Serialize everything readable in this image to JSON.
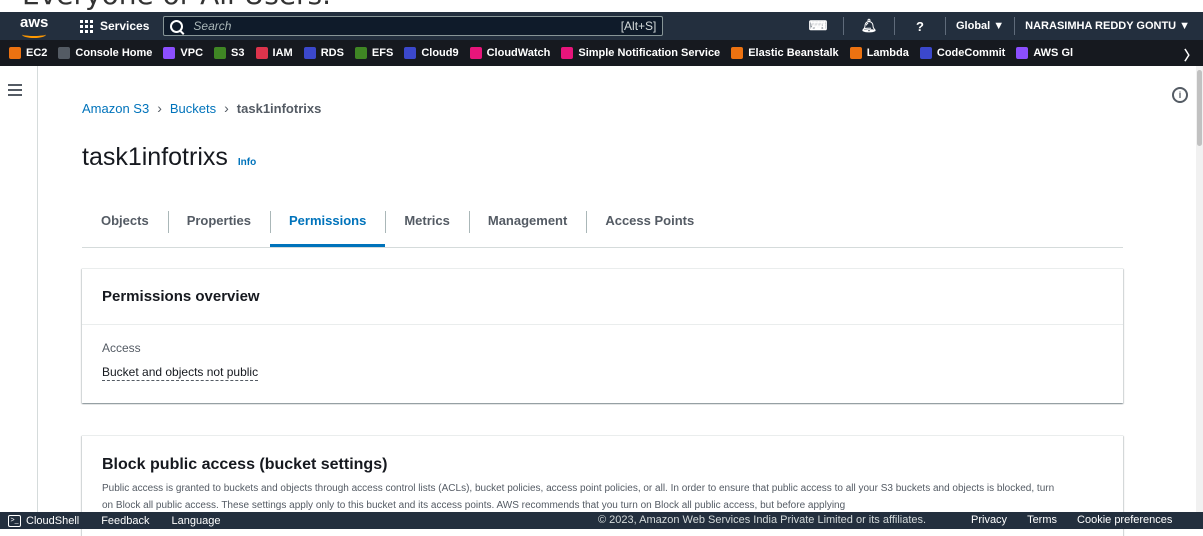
{
  "caption": "Everyone or All Users.",
  "topnav": {
    "logo": "aws",
    "services_label": "Services",
    "search_placeholder": "Search",
    "search_shortcut": "[Alt+S]",
    "region": "Global ▼",
    "account": "NARASIMHA REDDY GONTU ▼"
  },
  "favorites": [
    {
      "label": "EC2",
      "color": "#ec7211"
    },
    {
      "label": "Console Home",
      "color": "#545b64"
    },
    {
      "label": "VPC",
      "color": "#8c4fff"
    },
    {
      "label": "S3",
      "color": "#3f8624"
    },
    {
      "label": "IAM",
      "color": "#dd344c"
    },
    {
      "label": "RDS",
      "color": "#3b48cc"
    },
    {
      "label": "EFS",
      "color": "#3f8624"
    },
    {
      "label": "Cloud9",
      "color": "#3b48cc"
    },
    {
      "label": "CloudWatch",
      "color": "#e7157b"
    },
    {
      "label": "Simple Notification Service",
      "color": "#e7157b"
    },
    {
      "label": "Elastic Beanstalk",
      "color": "#ec7211"
    },
    {
      "label": "Lambda",
      "color": "#ec7211"
    },
    {
      "label": "CodeCommit",
      "color": "#3b48cc"
    },
    {
      "label": "AWS Gl",
      "color": "#8c4fff"
    }
  ],
  "breadcrumb": {
    "item1": "Amazon S3",
    "item2": "Buckets",
    "current": "task1infotrixs"
  },
  "page": {
    "title": "task1infotrixs",
    "info_link": "Info"
  },
  "tabs": [
    "Objects",
    "Properties",
    "Permissions",
    "Metrics",
    "Management",
    "Access Points"
  ],
  "permissions_overview": {
    "title": "Permissions overview",
    "access_label": "Access",
    "access_value": "Bucket and objects not public"
  },
  "block_public_access": {
    "title": "Block public access (bucket settings)",
    "description": "Public access is granted to buckets and objects through access control lists (ACLs), bucket policies, access point policies, or all. In order to ensure that public access to all your S3 buckets and objects is blocked, turn on Block all public access. These settings apply only to this bucket and its access points. AWS recommends that you turn on Block all public access, but before applying"
  },
  "footer": {
    "cloudshell": "CloudShell",
    "feedback": "Feedback",
    "language": "Language",
    "copyright": "© 2023, Amazon Web Services India Private Limited or its affiliates.",
    "privacy": "Privacy",
    "terms": "Terms",
    "cookies": "Cookie preferences"
  },
  "colors": {
    "nav_bg": "#232f3e",
    "fav_bg": "#16191f",
    "link": "#0073bb",
    "accent": "#ff9900"
  }
}
